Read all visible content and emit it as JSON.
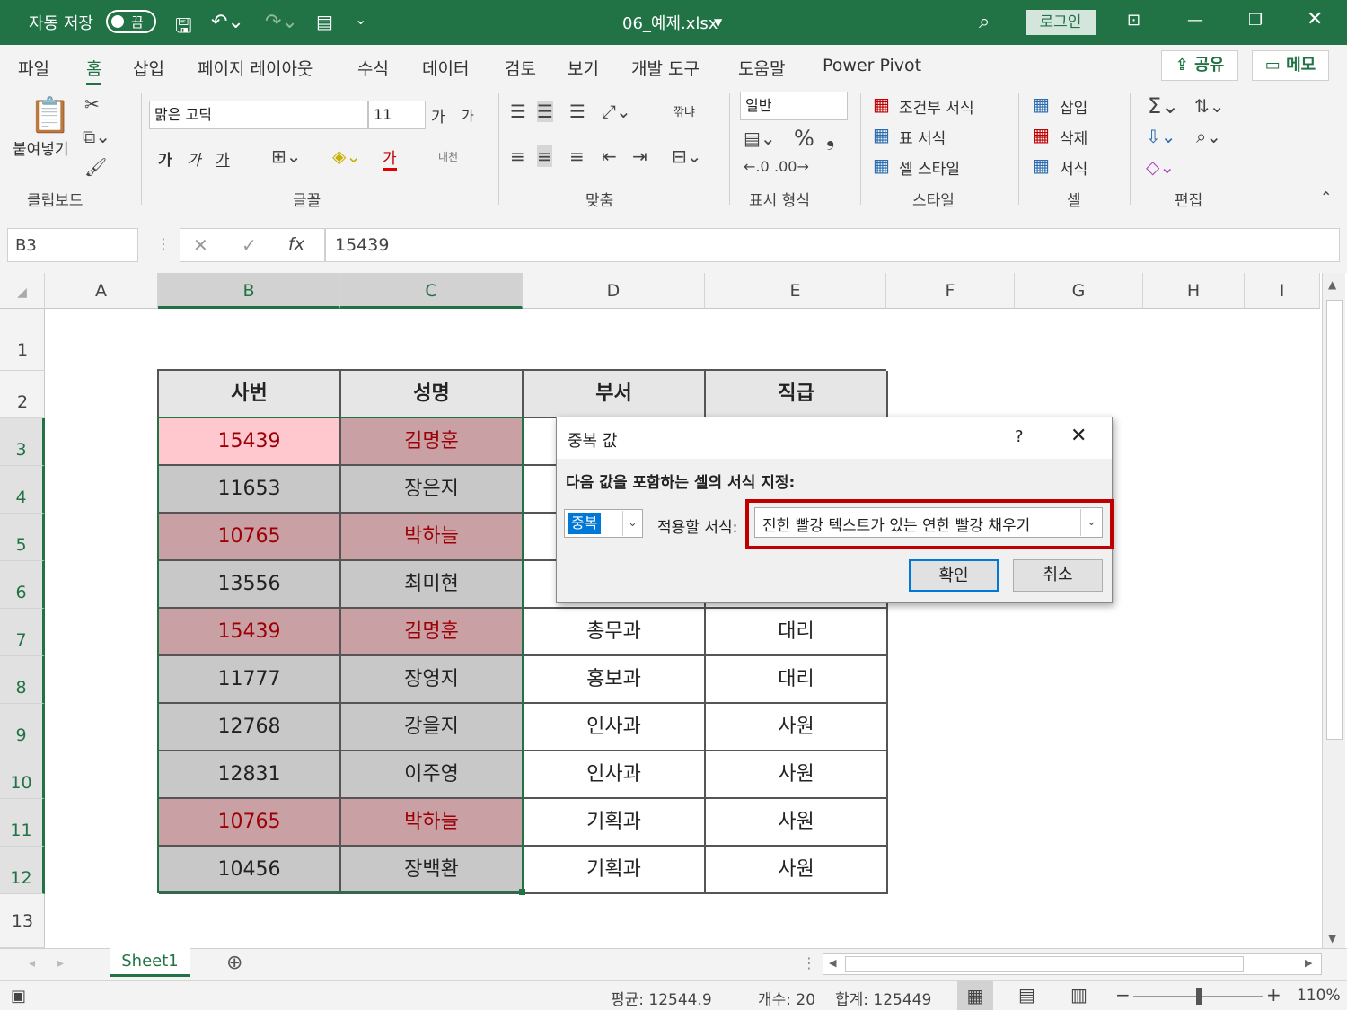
{
  "titlebar": {
    "autosave": "자동 저장",
    "toggle": "끔",
    "filename": "06_예제.xlsx",
    "login": "로그인"
  },
  "menu": {
    "items": [
      "파일",
      "홈",
      "삽입",
      "페이지 레이아웃",
      "수식",
      "데이터",
      "검토",
      "보기",
      "개발 도구",
      "도움말",
      "Power Pivot"
    ],
    "share": "공유",
    "memo": "메모"
  },
  "ribbon": {
    "clipboard": {
      "paste": "붙여넣기",
      "group": "클립보드"
    },
    "font": {
      "name": "맑은 고딕",
      "size": "11",
      "grow": "가",
      "shrink": "가",
      "bold": "가",
      "italic": "가",
      "underline": "가",
      "fontcolor": "가",
      "phonetic": "내천",
      "group": "글꼴"
    },
    "align": {
      "wrap": "깎냐",
      "group": "맞춤"
    },
    "number": {
      "format": "일반",
      "group": "표시 형식"
    },
    "styles": {
      "cond": "조건부 서식",
      "table": "표 서식",
      "cell": "셀 스타일",
      "group": "스타일"
    },
    "cells": {
      "insert": "삽입",
      "delete": "삭제",
      "format": "서식",
      "group": "셀"
    },
    "edit": {
      "group": "편집"
    }
  },
  "formula": {
    "namebox": "B3",
    "fx": "fx",
    "value": "15439"
  },
  "columns": [
    "A",
    "B",
    "C",
    "D",
    "E",
    "F",
    "G",
    "H",
    "I"
  ],
  "rows": [
    "1",
    "2",
    "3",
    "4",
    "5",
    "6",
    "7",
    "8",
    "9",
    "10",
    "11",
    "12",
    "13"
  ],
  "table": {
    "headers": [
      "사번",
      "성명",
      "부서",
      "직급"
    ],
    "rows": [
      [
        "15439",
        "김명훈",
        "",
        ""
      ],
      [
        "11653",
        "장은지",
        "",
        ""
      ],
      [
        "10765",
        "박하늘",
        "",
        ""
      ],
      [
        "13556",
        "최미현",
        "",
        ""
      ],
      [
        "15439",
        "김명훈",
        "총무과",
        "대리"
      ],
      [
        "11777",
        "장영지",
        "홍보과",
        "대리"
      ],
      [
        "12768",
        "강을지",
        "인사과",
        "사원"
      ],
      [
        "12831",
        "이주영",
        "인사과",
        "사원"
      ],
      [
        "10765",
        "박하늘",
        "기획과",
        "사원"
      ],
      [
        "10456",
        "장백환",
        "기획과",
        "사원"
      ]
    ]
  },
  "dialog": {
    "title": "중복 값",
    "help": "?",
    "prompt": "다음 값을 포함하는 셀의 서식 지정:",
    "type": "중복",
    "applylabel": "적용할 서식:",
    "format": "진한 빨강 텍스트가 있는 연한 빨강 채우기",
    "ok": "확인",
    "cancel": "취소"
  },
  "sheet": {
    "tab": "Sheet1"
  },
  "status": {
    "avg": "평균: 12544.9",
    "count": "개수: 20",
    "sum": "합계: 125449",
    "zoom": "110%"
  },
  "colors": {
    "accent": "#217346",
    "dupfill": "#ffc7ce",
    "duptext": "#9c0006",
    "highlight": "#c00000"
  }
}
